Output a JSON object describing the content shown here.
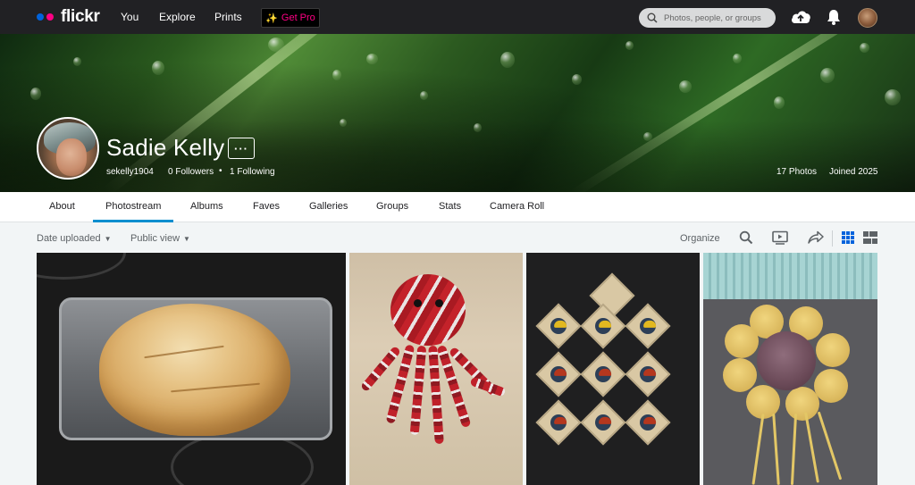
{
  "topnav": {
    "logo": "flickr",
    "links": [
      "You",
      "Explore",
      "Prints"
    ],
    "get_pro_label": "Get Pro",
    "search_placeholder": "Photos, people, or groups"
  },
  "profile": {
    "name": "Sadie Kelly",
    "more_label": "···",
    "screen_name": "sekelly1904",
    "followers": "0 Followers",
    "separator": "•",
    "following": "1 Following",
    "photos": "17 Photos",
    "joined": "Joined 2025"
  },
  "tabs": [
    "About",
    "Photostream",
    "Albums",
    "Faves",
    "Galleries",
    "Groups",
    "Stats",
    "Camera Roll"
  ],
  "active_tab": "Photostream",
  "toolbar": {
    "sort_label": "Date uploaded",
    "visibility_label": "Public view",
    "organize_label": "Organize"
  },
  "colors": {
    "brand_blue": "#0063dc",
    "brand_pink": "#ff0084",
    "accent_underline": "#008ecf",
    "nav_bg": "#212124"
  },
  "icons": [
    "search-icon",
    "upload-cloud-icon",
    "bell-icon",
    "slideshow-icon",
    "share-icon",
    "grid-view-icon",
    "justified-view-icon"
  ]
}
